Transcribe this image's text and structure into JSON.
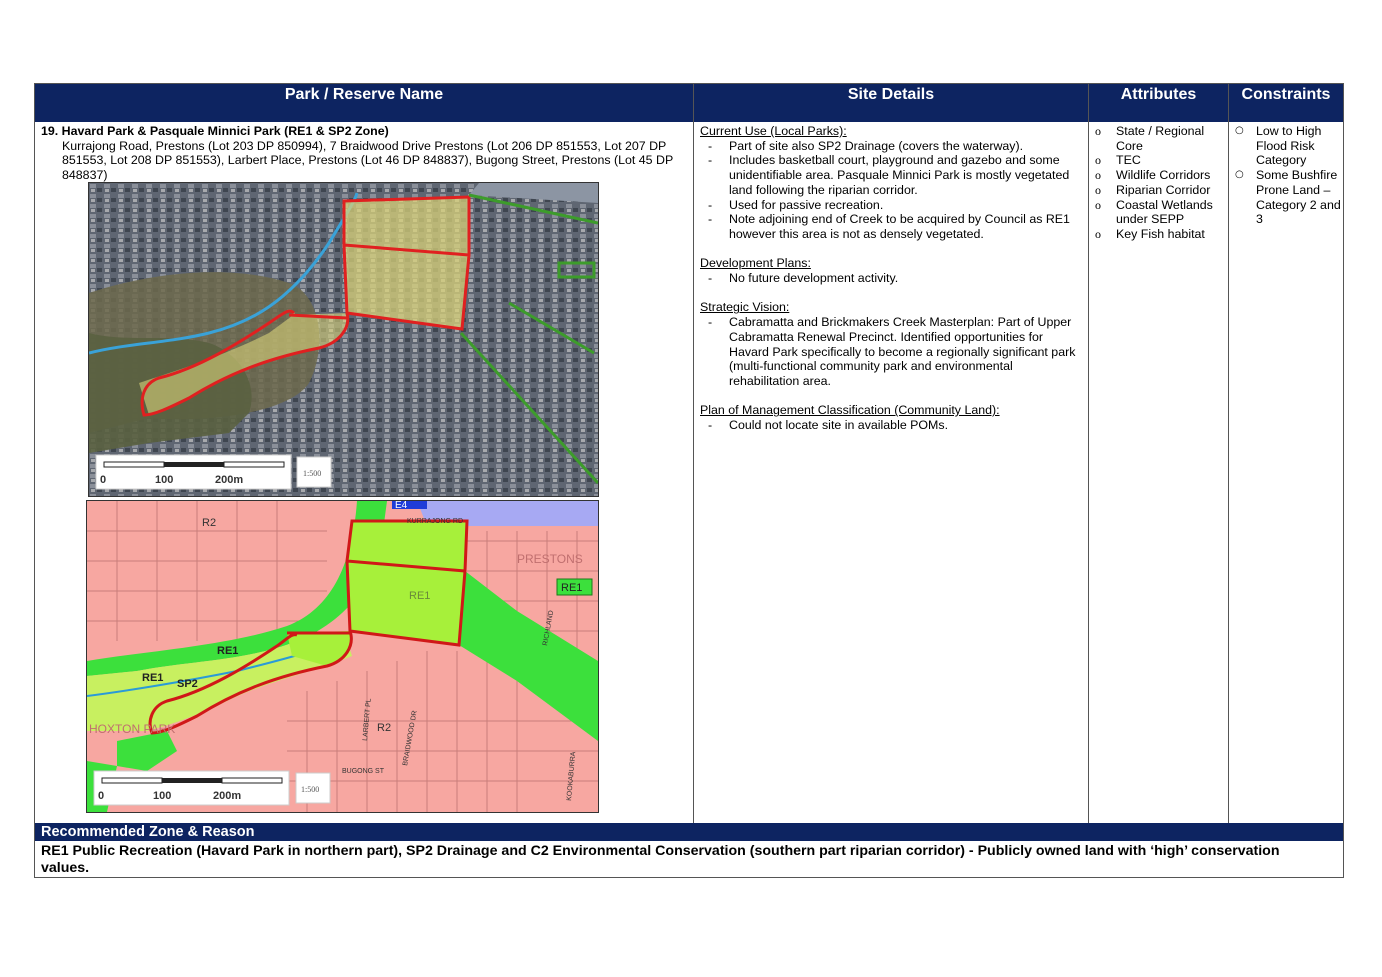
{
  "header": {
    "col1": "Park / Reserve Name",
    "col2": "Site Details",
    "col3": "Attributes",
    "col4": "Constraints"
  },
  "park": {
    "title": "19. Havard Park & Pasquale Minnici Park (RE1 & SP2 Zone)",
    "address": "Kurrajong Road, Prestons (Lot 203 DP 850994), 7 Braidwood Drive Prestons (Lot 206 DP 851553, Lot 207 DP 851553, Lot 208 DP 851553), Larbert Place, Prestons (Lot 46 DP 848837), Bugong Street, Prestons (Lot 45 DP 848837)"
  },
  "aerial_map": {
    "scale_labels": [
      "0",
      "100",
      "200m"
    ],
    "scale_badge": "1:500"
  },
  "zoning_map": {
    "labels": {
      "r2_a": "R2",
      "r2_b": "R2",
      "re1_main": "RE1",
      "re1_right": "RE1",
      "re1_creek": "RE1",
      "re1_left": "RE1",
      "sp2": "SP2",
      "e4": "E4",
      "prestons": "PRESTONS",
      "hoxton": "HOXTON PARK",
      "kurrajong": "KURRAJONG RD",
      "bugong": "BUGONG ST",
      "braidwood": "BRAIDWOOD DR",
      "larbert": "LARBERT PL",
      "richland": "RICHLAND",
      "kookaburra": "KOOKABURRA"
    },
    "scale_labels": [
      "0",
      "100",
      "200m"
    ],
    "scale_badge": "1:500"
  },
  "site_details": {
    "current_use_heading": "Current Use (Local Parks):",
    "current_use_items": [
      "Part of site also SP2 Drainage (covers the waterway).",
      "Includes basketball court, playground and gazebo and some unidentifiable area. Pasquale Minnici Park is mostly vegetated land following the riparian corridor.",
      "Used for passive recreation.",
      "Note adjoining end of Creek to be acquired by Council as RE1 however this area is not as densely vegetated."
    ],
    "dev_plans_heading": "Development Plans:",
    "dev_plans_items": [
      "No future development activity."
    ],
    "strategic_heading": "Strategic Vision:",
    "strategic_items": [
      "Cabramatta and Brickmakers Creek Masterplan: Part of Upper Cabramatta Renewal Precinct. Identified opportunities for Havard Park specifically to become a regionally significant park (multi-functional community park and environmental rehabilitation area."
    ],
    "pom_heading": "Plan of Management Classification (Community Land):",
    "pom_items": [
      "Could not locate site in available POMs."
    ]
  },
  "attributes": [
    "State / Regional Core",
    "TEC",
    "Wildlife Corridors",
    "Riparian Corridor",
    "Coastal Wetlands under SEPP",
    "Key Fish habitat"
  ],
  "constraints": [
    "Low to High Flood Risk Category",
    "Some Bushfire Prone Land – Category 2 and 3"
  ],
  "recommended": {
    "heading": "Recommended Zone & Reason",
    "text": "RE1 Public Recreation (Havard Park in northern part), SP2 Drainage and C2 Environmental Conservation (southern part riparian corridor) - Publicly owned land with ‘high’ conservation values."
  }
}
